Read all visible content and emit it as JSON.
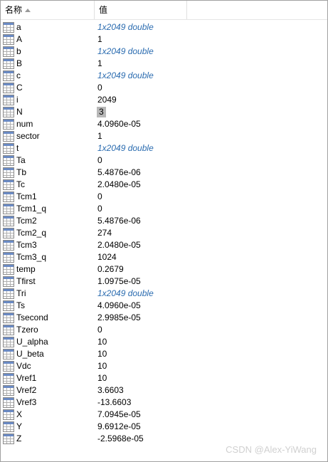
{
  "header": {
    "name": "名称",
    "value": "值"
  },
  "variables": [
    {
      "name": "a",
      "value": "1x2049 double",
      "italic": true
    },
    {
      "name": "A",
      "value": "1"
    },
    {
      "name": "b",
      "value": "1x2049 double",
      "italic": true
    },
    {
      "name": "B",
      "value": "1"
    },
    {
      "name": "c",
      "value": "1x2049 double",
      "italic": true
    },
    {
      "name": "C",
      "value": "0"
    },
    {
      "name": "i",
      "value": "2049"
    },
    {
      "name": "N",
      "value": "3",
      "selected": true
    },
    {
      "name": "num",
      "value": "4.0960e-05"
    },
    {
      "name": "sector",
      "value": "1"
    },
    {
      "name": "t",
      "value": "1x2049 double",
      "italic": true
    },
    {
      "name": "Ta",
      "value": "0"
    },
    {
      "name": "Tb",
      "value": "5.4876e-06"
    },
    {
      "name": "Tc",
      "value": "2.0480e-05"
    },
    {
      "name": "Tcm1",
      "value": "0"
    },
    {
      "name": "Tcm1_q",
      "value": "0"
    },
    {
      "name": "Tcm2",
      "value": "5.4876e-06"
    },
    {
      "name": "Tcm2_q",
      "value": "274"
    },
    {
      "name": "Tcm3",
      "value": "2.0480e-05"
    },
    {
      "name": "Tcm3_q",
      "value": "1024"
    },
    {
      "name": "temp",
      "value": "0.2679"
    },
    {
      "name": "Tfirst",
      "value": "1.0975e-05"
    },
    {
      "name": "Tri",
      "value": "1x2049 double",
      "italic": true
    },
    {
      "name": "Ts",
      "value": "4.0960e-05"
    },
    {
      "name": "Tsecond",
      "value": "2.9985e-05"
    },
    {
      "name": "Tzero",
      "value": "0"
    },
    {
      "name": "U_alpha",
      "value": "10"
    },
    {
      "name": "U_beta",
      "value": "10"
    },
    {
      "name": "Vdc",
      "value": "10"
    },
    {
      "name": "Vref1",
      "value": "10"
    },
    {
      "name": "Vref2",
      "value": "3.6603"
    },
    {
      "name": "Vref3",
      "value": "-13.6603"
    },
    {
      "name": "X",
      "value": "7.0945e-05"
    },
    {
      "name": "Y",
      "value": "9.6912e-05"
    },
    {
      "name": "Z",
      "value": "-2.5968e-05"
    }
  ],
  "watermark": "CSDN @Alex-YiWang",
  "icons": {
    "variable": "matrix-variable-icon",
    "sort": "sort-ascending-icon"
  }
}
